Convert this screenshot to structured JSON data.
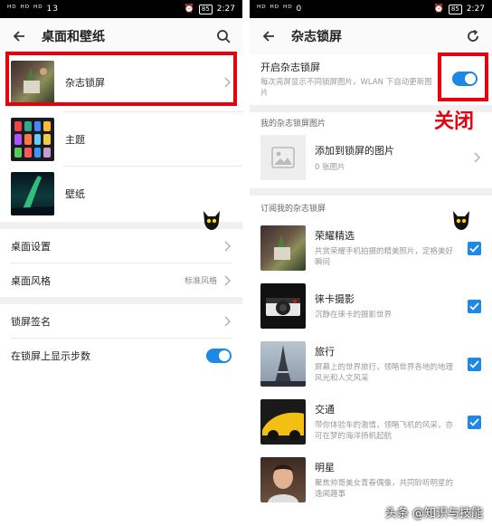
{
  "left": {
    "status": {
      "signal": "ᴴᴰ ᴴᴰ ᴴᴰ",
      "speed": "13\nB/s",
      "time": "2:27",
      "battery": "85"
    },
    "title": "桌面和壁纸",
    "items": [
      {
        "label": "杂志锁屏"
      },
      {
        "label": "主题"
      },
      {
        "label": "壁纸"
      }
    ],
    "rows": [
      {
        "label": "桌面设置",
        "value": ""
      },
      {
        "label": "桌面风格",
        "value": "标准风格"
      },
      {
        "label": "锁屏签名",
        "value": ""
      },
      {
        "label": "在锁屏上显示步数",
        "value": ""
      }
    ]
  },
  "right": {
    "status": {
      "speed": "0\nK/s",
      "time": "2:27",
      "battery": "85"
    },
    "title": "杂志锁屏",
    "toggle_title": "开启杂志锁屏",
    "toggle_desc": "每次亮屏显示不同锁屏图片，WLAN 下自动更新图片",
    "annotation": "关闭",
    "my_section": "我的杂志锁屏图片",
    "add_title": "添加到锁屏的图片",
    "add_count": "0 张图片",
    "sub_section": "订阅我的杂志锁屏",
    "magazines": [
      {
        "title": "荣耀精选",
        "desc": "共赏荣耀手机拍摄的精美照片，定格美好瞬间"
      },
      {
        "title": "徕卡摄影",
        "desc": "沉静在徕卡的摄影世界"
      },
      {
        "title": "旅行",
        "desc": "屏幕上的世界旅行，领略世界各地的地理风光和人文风采"
      },
      {
        "title": "交通",
        "desc": "带你体验车的激情，领略飞机的风采，亦可在梦的海洋扬帆起航"
      },
      {
        "title": "明星",
        "desc": "聚焦帅哥美女青春偶像，共同聆听明星的逸闻趣事"
      }
    ]
  },
  "watermark": "头条 @知识与技能",
  "colors": {
    "accent": "#1e88e5",
    "highlight": "#e8000d"
  }
}
